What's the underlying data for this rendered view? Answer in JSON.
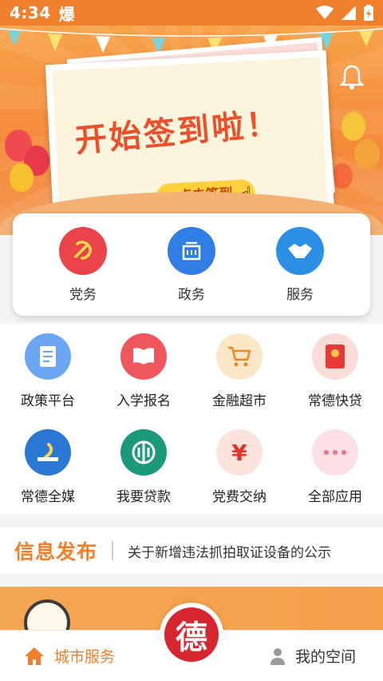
{
  "status_bar": {
    "time": "4:34",
    "carrier_glyph": "爆",
    "icons": [
      "wifi-icon",
      "signal-icon",
      "battery-icon"
    ]
  },
  "banner": {
    "headline": "开始签到啦！",
    "checkin_button": "点击签到",
    "slide_count": 4,
    "active_slide": 1
  },
  "services": [
    {
      "label": "党务",
      "icon": "party-emblem-icon",
      "color": "#e9444a"
    },
    {
      "label": "政务",
      "icon": "government-building-icon",
      "color": "#2f7ee6"
    },
    {
      "label": "服务",
      "icon": "handshake-icon",
      "color": "#2b8fe3"
    }
  ],
  "apps": [
    {
      "label": "政策平台",
      "icon": "policy-document-icon",
      "color": "#6aa6f2"
    },
    {
      "label": "入学报名",
      "icon": "book-enrollment-icon",
      "color": "#f0565e"
    },
    {
      "label": "金融超市",
      "icon": "shopping-cart-icon",
      "color": "#fbe6c8"
    },
    {
      "label": "常德快贷",
      "icon": "red-envelope-icon",
      "color": "#fbdcd7"
    },
    {
      "label": "常德全媒",
      "icon": "media-logo-icon",
      "color": "#2a78d4"
    },
    {
      "label": "我要贷款",
      "icon": "bank-logo-icon",
      "color": "#1a9a7a"
    },
    {
      "label": "党费交纳",
      "icon": "yuan-icon",
      "color": "#fbe3dc"
    },
    {
      "label": "全部应用",
      "icon": "more-dots-icon",
      "color": "#fde0e3"
    }
  ],
  "news": {
    "title": "信息发布",
    "headline": "关于新增违法抓拍取证设备的公示"
  },
  "bottom_nav": {
    "city_service": "城市服务",
    "center_label": "德",
    "my_space": "我的空间"
  },
  "colors": {
    "accent": "#f07f2c",
    "party_red": "#d6262f"
  }
}
